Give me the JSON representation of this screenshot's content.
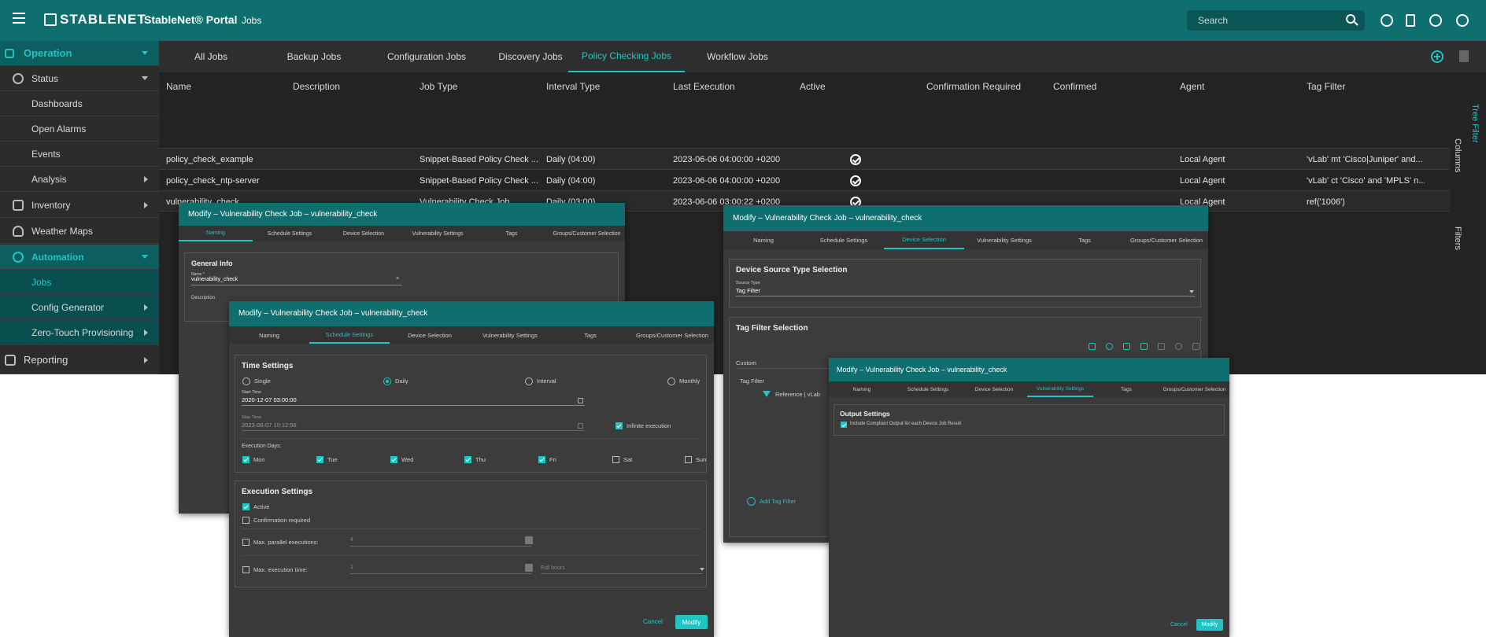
{
  "header": {
    "logo": "STABLENET",
    "product": "StableNet® Portal",
    "page": "Jobs",
    "search_placeholder": "Search",
    "icons": [
      "info-icon",
      "bookmark-icon",
      "health-icon",
      "user-icon"
    ]
  },
  "sidebar": {
    "operation": "Operation",
    "status": "Status",
    "dashboards": "Dashboards",
    "open_alarms": "Open Alarms",
    "events": "Events",
    "analysis": "Analysis",
    "inventory": "Inventory",
    "weather_maps": "Weather Maps",
    "automation": "Automation",
    "jobs": "Jobs",
    "config_generator": "Config Generator",
    "zero_touch": "Zero-Touch Provisioning",
    "reporting": "Reporting"
  },
  "tabs": [
    "All Jobs",
    "Backup Jobs",
    "Configuration Jobs",
    "Discovery Jobs",
    "Policy Checking Jobs",
    "Workflow Jobs"
  ],
  "table": {
    "headers": [
      "Name",
      "Description",
      "Job Type",
      "Interval Type",
      "Last Execution",
      "Active",
      "Confirmation Required",
      "Confirmed",
      "Agent",
      "Tag Filter"
    ],
    "rows": [
      {
        "name": "policy_check_example",
        "description": "",
        "job_type": "Snippet-Based Policy Check ...",
        "interval": "Daily (04:00)",
        "last_exec": "2023-06-06 04:00:00 +0200",
        "agent": "Local Agent",
        "tag_filter": "'vLab' mt 'Cisco|Juniper' and..."
      },
      {
        "name": "policy_check_ntp-server",
        "description": "",
        "job_type": "Snippet-Based Policy Check ...",
        "interval": "Daily (04:00)",
        "last_exec": "2023-06-06 04:00:00 +0200",
        "agent": "Local Agent",
        "tag_filter": "'vLab' ct 'Cisco' and 'MPLS' n..."
      },
      {
        "name": "vulnerability_check",
        "description": "",
        "job_type": "Vulnerability Check Job",
        "interval": "Daily (03:00)",
        "last_exec": "2023-06-06 03:00:22 +0200",
        "agent": "Local Agent",
        "tag_filter": "ref('1006')"
      }
    ]
  },
  "rail": {
    "tree_filter": "Tree Filter",
    "columns": "Columns",
    "filters": "Filters"
  },
  "dialog_tabs": [
    "Naming",
    "Schedule Settings",
    "Device Selection",
    "Vulnerability Settings",
    "Tags",
    "Groups/Customer Selection"
  ],
  "dlg1": {
    "title": "Modify – Vulnerability Check Job – vulnerability_check",
    "panel_title": "General Info",
    "name_label": "Name *",
    "name_value": "vulnerability_check",
    "description_label": "Description"
  },
  "dlg2": {
    "title": "Modify – Vulnerability Check Job – vulnerability_check",
    "time_settings": "Time Settings",
    "radios": [
      "Single",
      "Daily",
      "Interval",
      "Monthly"
    ],
    "start_label": "Start Time",
    "start_value": "2020-12-07 03:00:00",
    "stop_label": "Stop Time",
    "stop_value": "2023-06-07 10:12:56",
    "infinite": "Infinite execution",
    "exec_days_label": "Execution Days:",
    "days": [
      "Mon",
      "Tue",
      "Wed",
      "Thu",
      "Fri",
      "Sat",
      "Sun"
    ],
    "exec_settings": "Execution Settings",
    "active": "Active",
    "confirmation": "Confirmation required",
    "max_parallel": "Max. parallel executions:",
    "max_parallel_value": "4",
    "max_time": "Max. execution time:",
    "max_time_value": "1",
    "full_hours": "Full hours",
    "cancel": "Cancel",
    "modify": "Modify"
  },
  "dlg3": {
    "title": "Modify – Vulnerability Check Job – vulnerability_check",
    "source_title": "Device Source Type Selection",
    "source_label": "Source Type",
    "source_value": "Tag Filter",
    "tag_title": "Tag Filter Selection",
    "custom": "Custom",
    "tag_filter": "Tag Filter",
    "reference": "Reference | vLab",
    "add_tag": "Add Tag Filter"
  },
  "dlg4": {
    "title": "Modify – Vulnerability Check Job – vulnerability_check",
    "output_title": "Output Settings",
    "include": "Include Compliant Output for each Device Job Result",
    "cancel": "Cancel",
    "modify": "Modify"
  }
}
